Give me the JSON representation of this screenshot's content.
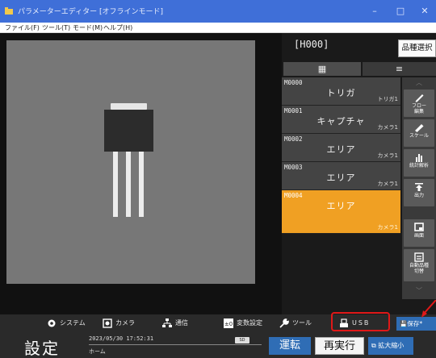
{
  "window": {
    "title": "パラメーターエディター [オフラインモード]",
    "buttons": {
      "minimize": "–",
      "maximize": "□",
      "close": "✕"
    }
  },
  "menu": {
    "file": "ファイル(F)",
    "tool": "ツール(T)",
    "mode": "モード(M)",
    "help": "ヘルプ(H)"
  },
  "header": {
    "program_id": "[H000]",
    "product_select": "品種選択"
  },
  "view_tabs": {
    "grid": "▦",
    "list": "≡"
  },
  "flow_items": [
    {
      "code": "M0000",
      "name": "トリガ",
      "sub": "トリガ1",
      "selected": false
    },
    {
      "code": "M0001",
      "name": "キャプチャ",
      "sub": "カメラ1",
      "selected": false
    },
    {
      "code": "M0002",
      "name": "エリア",
      "sub": "カメラ1",
      "selected": false
    },
    {
      "code": "M0003",
      "name": "エリア",
      "sub": "カメラ1",
      "selected": false
    },
    {
      "code": "M0004",
      "name": "エリア",
      "sub": "カメラ1",
      "selected": true
    }
  ],
  "side_toolbar": {
    "scroll_up": "︿",
    "scroll_down": "﹀",
    "items": [
      {
        "label": "フロー\n編集",
        "icon": "pencil-icon"
      },
      {
        "label": "スケール",
        "icon": "ruler-icon"
      },
      {
        "label": "統計解析",
        "icon": "bar-chart-icon"
      },
      {
        "label": "出力",
        "icon": "output-icon"
      },
      {
        "label": "画面",
        "icon": "screen-icon"
      },
      {
        "label": "自動品種\n切替",
        "icon": "auto-switch-icon"
      }
    ]
  },
  "bottom_tabs": {
    "system": "システム",
    "camera": "カメラ",
    "comm": "通信",
    "variable": "変数設定",
    "tool": "ツール",
    "usb": "USB",
    "save": "保存*"
  },
  "status": {
    "mode": "設定",
    "datetime": "2023/05/30 17:52:31",
    "page": "ホーム",
    "sd": "SD"
  },
  "actions": {
    "run": "運転",
    "rerun": "再実行",
    "zoom": "拡大縮小"
  },
  "colors": {
    "titlebar": "#3f6fd8",
    "selected_item": "#f0a023",
    "accent_blue": "#2f6db5",
    "highlight_red": "#e01818"
  }
}
